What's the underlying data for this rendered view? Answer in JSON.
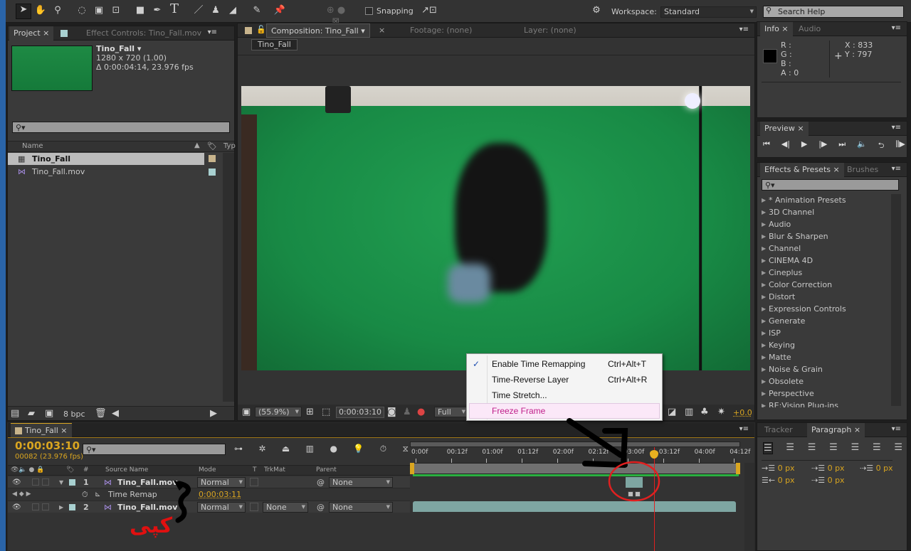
{
  "toolbar": {
    "snapping_label": "Snapping",
    "workspace_label": "Workspace:",
    "workspace_value": "Standard",
    "search_placeholder": "Search Help",
    "tools": [
      "selection-tool",
      "hand-tool",
      "zoom-tool",
      "rotate-tool",
      "camera-tool",
      "pan-behind-tool",
      "rectangle-tool",
      "pen-tool",
      "type-tool",
      "brush-tool",
      "clone-stamp-tool",
      "eraser-tool",
      "roto-brush-tool",
      "puppet-pin-tool"
    ]
  },
  "project": {
    "tab": "Project",
    "effect_controls_tab": "Effect Controls: Tino_Fall.mov",
    "item_name": "Tino_Fall",
    "item_res": "1280 x 720 (1.00)",
    "item_duration": "Δ 0:00:04:14, 23.976 fps",
    "col_name": "Name",
    "col_type": "Typ",
    "items": [
      {
        "name": "Tino_Fall",
        "type": "composition",
        "color": "#c8b48c"
      },
      {
        "name": "Tino_Fall.mov",
        "type": "footage",
        "color": "#a8d0d0"
      }
    ],
    "bpc": "8 bpc"
  },
  "composition": {
    "tab": "Composition: Tino_Fall",
    "footage_tab": "Footage: (none)",
    "layer_tab": "Layer: (none)",
    "breadcrumb": "Tino_Fall",
    "zoom": "(55.9%)",
    "timecode": "0:00:03:10",
    "resolution": "Full",
    "exposure": "+0.0"
  },
  "info": {
    "tab": "Info",
    "audio_tab": "Audio",
    "r": "R :",
    "g": "G :",
    "b": "B :",
    "a": "A : 0",
    "x": "X : 833",
    "y": "Y : 797"
  },
  "preview": {
    "tab": "Preview"
  },
  "effects": {
    "tab": "Effects & Presets",
    "brushes_tab": "Brushes",
    "items": [
      "* Animation Presets",
      "3D Channel",
      "Audio",
      "Blur & Sharpen",
      "Channel",
      "CINEMA 4D",
      "Cineplus",
      "Color Correction",
      "Distort",
      "Expression Controls",
      "Generate",
      "ISP",
      "Keying",
      "Matte",
      "Noise & Grain",
      "Obsolete",
      "Perspective",
      "RE:Vision Plug-ins"
    ]
  },
  "context_menu": {
    "items": [
      {
        "label": "Enable Time Remapping",
        "shortcut": "Ctrl+Alt+T",
        "checked": true
      },
      {
        "label": "Time-Reverse Layer",
        "shortcut": "Ctrl+Alt+R"
      },
      {
        "label": "Time Stretch...",
        "shortcut": ""
      },
      {
        "label": "Freeze Frame",
        "shortcut": "",
        "highlighted": true
      }
    ]
  },
  "timeline": {
    "tab": "Tino_Fall",
    "timecode": "0:00:03:10",
    "frames": "00082 (23.976 fps)",
    "columns": {
      "num": "#",
      "source": "Source Name",
      "mode": "Mode",
      "t": "T",
      "trkmat": "TrkMat",
      "parent": "Parent"
    },
    "layers": [
      {
        "num": "1",
        "name": "Tino_Fall.mov",
        "mode": "Normal",
        "trkmat": "",
        "parent": "None"
      },
      {
        "num": "2",
        "name": "Tino_Fall.mov",
        "mode": "Normal",
        "trkmat": "None",
        "parent": "None"
      }
    ],
    "time_remap_label": "Time Remap",
    "time_remap_value": "0:00:03:11",
    "ruler": [
      "0:00f",
      "00:12f",
      "01:00f",
      "01:12f",
      "02:00f",
      "02:12f",
      "03:00f",
      "03:12f",
      "04:00f",
      "04:12f"
    ]
  },
  "tracker": {
    "tab": "Tracker"
  },
  "paragraph": {
    "tab": "Paragraph",
    "indent_values": [
      "0 px",
      "0 px",
      "0 px",
      "0 px",
      "0 px"
    ]
  },
  "annotation": {
    "text": "کپی",
    "colors": {
      "arrow": "#000000",
      "circle": "#e02020",
      "text": "#e01010"
    }
  }
}
